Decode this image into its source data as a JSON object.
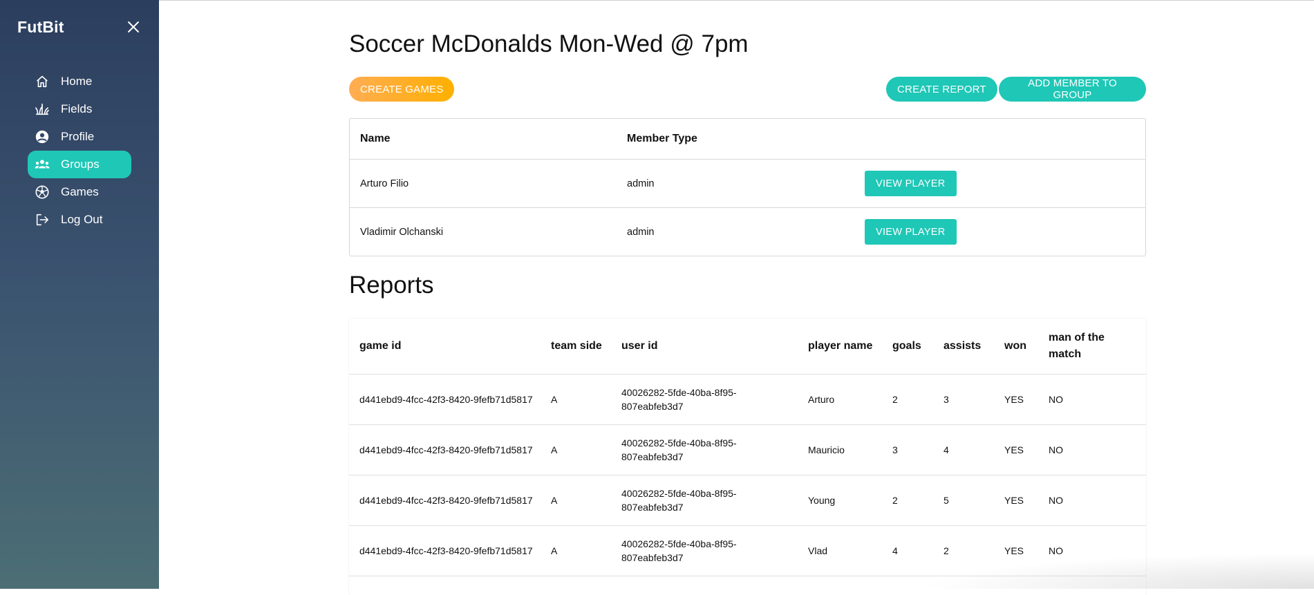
{
  "app": {
    "brand": "FutBit"
  },
  "sidebar": {
    "items": [
      {
        "label": "Home",
        "icon": "home-icon",
        "active": false
      },
      {
        "label": "Fields",
        "icon": "grass-icon",
        "active": false
      },
      {
        "label": "Profile",
        "icon": "account-circle-icon",
        "active": false
      },
      {
        "label": "Groups",
        "icon": "groups-icon",
        "active": true
      },
      {
        "label": "Games",
        "icon": "soccer-ball-icon",
        "active": false
      },
      {
        "label": "Log Out",
        "icon": "logout-icon",
        "active": false
      }
    ]
  },
  "page": {
    "title": "Soccer McDonalds Mon-Wed @ 7pm",
    "create_games_label": "CREATE GAMES",
    "create_report_label": "CREATE REPORT",
    "add_member_label": "ADD MEMBER TO GROUP"
  },
  "members": {
    "headers": {
      "name": "Name",
      "member_type": "Member Type"
    },
    "view_label": "VIEW PLAYER",
    "rows": [
      {
        "name": "Arturo Filio",
        "type": "admin"
      },
      {
        "name": "Vladimir Olchanski",
        "type": "admin"
      }
    ]
  },
  "reports": {
    "title": "Reports",
    "headers": [
      "game id",
      "team side",
      "user id",
      "player name",
      "goals",
      "assists",
      "won",
      "man of the match"
    ],
    "rows": [
      {
        "game_id": "d441ebd9-4fcc-42f3-8420-9fefb71d5817",
        "team_side": "A",
        "user_id": "40026282-5fde-40ba-8f95-807eabfeb3d7",
        "player_name": "Arturo",
        "goals": "2",
        "assists": "3",
        "won": "YES",
        "motm": "NO"
      },
      {
        "game_id": "d441ebd9-4fcc-42f3-8420-9fefb71d5817",
        "team_side": "A",
        "user_id": "40026282-5fde-40ba-8f95-807eabfeb3d7",
        "player_name": "Mauricio",
        "goals": "3",
        "assists": "4",
        "won": "YES",
        "motm": "NO"
      },
      {
        "game_id": "d441ebd9-4fcc-42f3-8420-9fefb71d5817",
        "team_side": "A",
        "user_id": "40026282-5fde-40ba-8f95-807eabfeb3d7",
        "player_name": "Young",
        "goals": "2",
        "assists": "5",
        "won": "YES",
        "motm": "NO"
      },
      {
        "game_id": "d441ebd9-4fcc-42f3-8420-9fefb71d5817",
        "team_side": "A",
        "user_id": "40026282-5fde-40ba-8f95-807eabfeb3d7",
        "player_name": "Vlad",
        "goals": "4",
        "assists": "2",
        "won": "YES",
        "motm": "NO"
      }
    ]
  },
  "colors": {
    "accent": "#1fc7b6",
    "orange": "#ffad53",
    "sidebar_top": "#2c3e5e",
    "sidebar_bottom": "#4c6e74"
  }
}
